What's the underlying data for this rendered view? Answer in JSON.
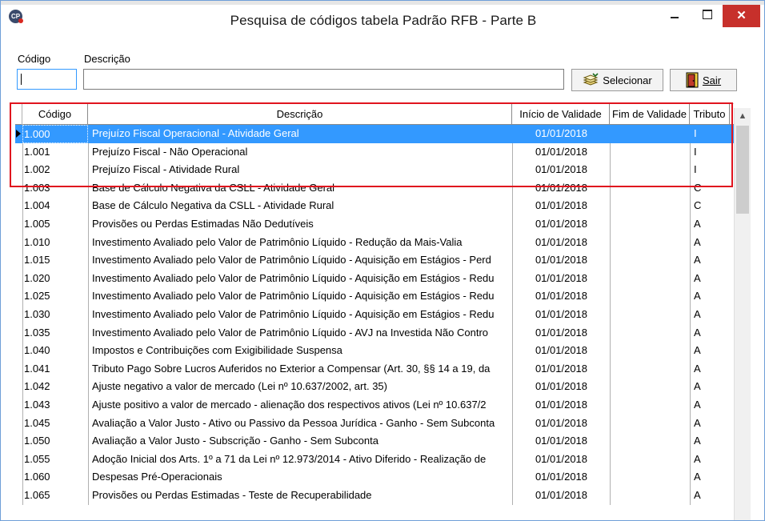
{
  "window": {
    "title": "Pesquisa de códigos tabela Padrão RFB - Parte B",
    "app_icon_text": "CP",
    "close_glyph": "✕"
  },
  "filters": {
    "codigo_label": "Código",
    "descricao_label": "Descrição",
    "codigo_value": "",
    "descricao_value": ""
  },
  "buttons": {
    "selecionar_prefix": "Selecionar",
    "sair_label": "Sair"
  },
  "table": {
    "columns": [
      "Código",
      "Descrição",
      "Início de Validade",
      "Fim de Validade",
      "Tributo"
    ],
    "rows": [
      {
        "codigo": "1.000",
        "descricao": "Prejuízo Fiscal Operacional - Atividade Geral",
        "inicio": "01/01/2018",
        "fim": "",
        "tributo": "I"
      },
      {
        "codigo": "1.001",
        "descricao": "Prejuízo Fiscal - Não Operacional",
        "inicio": "01/01/2018",
        "fim": "",
        "tributo": "I"
      },
      {
        "codigo": "1.002",
        "descricao": "Prejuízo Fiscal - Atividade Rural",
        "inicio": "01/01/2018",
        "fim": "",
        "tributo": "I"
      },
      {
        "codigo": "1.003",
        "descricao": "Base de Cálculo Negativa da CSLL - Atividade Geral",
        "inicio": "01/01/2018",
        "fim": "",
        "tributo": "C"
      },
      {
        "codigo": "1.004",
        "descricao": "Base de Cálculo Negativa da CSLL - Atividade Rural",
        "inicio": "01/01/2018",
        "fim": "",
        "tributo": "C"
      },
      {
        "codigo": "1.005",
        "descricao": "Provisões ou Perdas Estimadas Não Dedutíveis",
        "inicio": "01/01/2018",
        "fim": "",
        "tributo": "A"
      },
      {
        "codigo": "1.010",
        "descricao": "Investimento Avaliado pelo Valor de Patrimônio Líquido - Redução da Mais-Valia",
        "inicio": "01/01/2018",
        "fim": "",
        "tributo": "A"
      },
      {
        "codigo": "1.015",
        "descricao": "Investimento Avaliado pelo Valor de Patrimônio Líquido - Aquisição em Estágios - Perd",
        "inicio": "01/01/2018",
        "fim": "",
        "tributo": "A"
      },
      {
        "codigo": "1.020",
        "descricao": "Investimento Avaliado pelo Valor de Patrimônio Líquido - Aquisição em Estágios - Redu",
        "inicio": "01/01/2018",
        "fim": "",
        "tributo": "A"
      },
      {
        "codigo": "1.025",
        "descricao": "Investimento Avaliado pelo Valor de Patrimônio Líquido - Aquisição em Estágios - Redu",
        "inicio": "01/01/2018",
        "fim": "",
        "tributo": "A"
      },
      {
        "codigo": "1.030",
        "descricao": "Investimento Avaliado pelo Valor de Patrimônio Líquido - Aquisição em Estágios - Redu",
        "inicio": "01/01/2018",
        "fim": "",
        "tributo": "A"
      },
      {
        "codigo": "1.035",
        "descricao": "Investimento Avaliado pelo Valor de Patrimônio Líquido - AVJ na Investida Não Contro",
        "inicio": "01/01/2018",
        "fim": "",
        "tributo": "A"
      },
      {
        "codigo": "1.040",
        "descricao": "Impostos e Contribuições com Exigibilidade Suspensa",
        "inicio": "01/01/2018",
        "fim": "",
        "tributo": "A"
      },
      {
        "codigo": "1.041",
        "descricao": "Tributo Pago Sobre Lucros Auferidos no Exterior a Compensar (Art. 30, §§ 14 a 19, da",
        "inicio": "01/01/2018",
        "fim": "",
        "tributo": "A"
      },
      {
        "codigo": "1.042",
        "descricao": "Ajuste negativo a valor de mercado (Lei nº 10.637/2002, art. 35)",
        "inicio": "01/01/2018",
        "fim": "",
        "tributo": "A"
      },
      {
        "codigo": "1.043",
        "descricao": "Ajuste positivo a valor de mercado - alienação dos respectivos ativos (Lei nº 10.637/2",
        "inicio": "01/01/2018",
        "fim": "",
        "tributo": "A"
      },
      {
        "codigo": "1.045",
        "descricao": "Avaliação a Valor Justo - Ativo ou Passivo da Pessoa Jurídica - Ganho - Sem Subconta",
        "inicio": "01/01/2018",
        "fim": "",
        "tributo": "A"
      },
      {
        "codigo": "1.050",
        "descricao": "Avaliação a Valor Justo - Subscrição - Ganho - Sem Subconta",
        "inicio": "01/01/2018",
        "fim": "",
        "tributo": "A"
      },
      {
        "codigo": "1.055",
        "descricao": "Adoção Inicial dos Arts. 1º a 71 da Lei nº 12.973/2014 - Ativo Diferido - Realização de",
        "inicio": "01/01/2018",
        "fim": "",
        "tributo": "A"
      },
      {
        "codigo": "1.060",
        "descricao": "Despesas Pré-Operacionais",
        "inicio": "01/01/2018",
        "fim": "",
        "tributo": "A"
      },
      {
        "codigo": "1.065",
        "descricao": "Provisões ou Perdas Estimadas - Teste de Recuperabilidade",
        "inicio": "01/01/2018",
        "fim": "",
        "tributo": "A"
      }
    ],
    "selected_index": 0
  },
  "colors": {
    "selection": "#3399ff",
    "highlight_box": "#e0141e",
    "close_button": "#c7302b"
  }
}
